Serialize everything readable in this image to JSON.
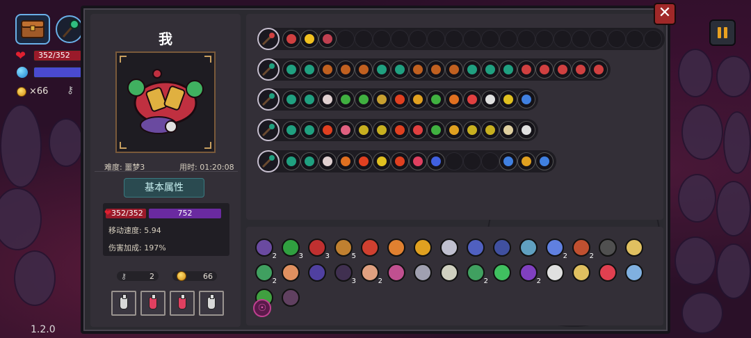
{
  "hud": {
    "hp": "352/352",
    "coins": "×66",
    "version": "1.2.0"
  },
  "player": {
    "name": "我",
    "difficulty": "难度: 噩梦3",
    "time": "用时: 01:20:08"
  },
  "stats": {
    "section_title": "基本属性",
    "hp": "352/352",
    "mp": "752",
    "move_speed": "移动速度: 5.94",
    "damage_bonus": "伤害加成: 197%"
  },
  "resources": {
    "keys": "2",
    "coins": "66"
  },
  "potions": [
    {
      "name": "empty-flask",
      "color": "#d8d8d8"
    },
    {
      "name": "health-potion",
      "color": "#e04060"
    },
    {
      "name": "health-potion",
      "color": "#e04060"
    },
    {
      "name": "empty-flask",
      "color": "#d8d8d8"
    }
  ],
  "loadout_rows": [
    {
      "weapon": "chest-bag-icon",
      "chips": [
        "#d04040",
        "#f0c020",
        "#c04050",
        "",
        "",
        "",
        "",
        "",
        "",
        "",
        "",
        "",
        "",
        "",
        "",
        "",
        "",
        "",
        "",
        "",
        ""
      ]
    },
    {
      "weapon": "green-staff-icon",
      "chips": [
        "#20a080",
        "#20a080",
        "#c06020",
        "#c06020",
        "#c06020",
        "#20a080",
        "#20a080",
        "#c06020",
        "#c06020",
        "#c06020",
        "#20a080",
        "#20a080",
        "#20a080",
        "#d04040",
        "#d04040",
        "#d04040",
        "#d04040",
        "#d04040"
      ]
    },
    {
      "weapon": "purple-staff-icon",
      "chips": [
        "#20a080",
        "#20a080",
        "#e0d0d0",
        "#40b040",
        "#40b040",
        "#c8a030",
        "#e04020",
        "#e0a020",
        "#40b040",
        "#e07020",
        "#e04040",
        "#e0e0e0",
        "#e0c020",
        "#4080e0"
      ]
    },
    {
      "weapon": "dark-staff-icon",
      "chips": [
        "#20a080",
        "#20a080",
        "#e04020",
        "#e06080",
        "#c8b020",
        "#c8b020",
        "#e04020",
        "#e04040",
        "#40b040",
        "#e0a020",
        "#c8b020",
        "#c8b020",
        "#e0d0a0",
        "#e0e0e0"
      ]
    },
    {
      "weapon": "spiked-staff-icon",
      "chips": [
        "#20a080",
        "#20a080",
        "#e0d0d0",
        "#e07020",
        "#e04020",
        "#e0c020",
        "#e04020",
        "#e04060",
        "#4060e0",
        "",
        "",
        "",
        "#4080e0",
        "#e0a020",
        "#4080e0"
      ]
    }
  ],
  "inventory": [
    {
      "name": "hood-item",
      "color": "#6a4aa0",
      "count": "2"
    },
    {
      "name": "claw-item",
      "color": "#30a040",
      "count": "3"
    },
    {
      "name": "demon-mask-item",
      "color": "#c03030",
      "count": "3"
    },
    {
      "name": "pickaxe-item",
      "color": "#c08030",
      "count": "5"
    },
    {
      "name": "eye-bat-item",
      "color": "#d04030",
      "count": ""
    },
    {
      "name": "scroll-item",
      "color": "#e08030",
      "count": ""
    },
    {
      "name": "glove-item",
      "color": "#e0a020",
      "count": ""
    },
    {
      "name": "dagger-item",
      "color": "#c0c0d0",
      "count": ""
    },
    {
      "name": "grimoire-item",
      "color": "#5060c0",
      "count": ""
    },
    {
      "name": "beetle-item",
      "color": "#4050a0",
      "count": ""
    },
    {
      "name": "compass-item",
      "color": "#60a0c0",
      "count": ""
    },
    {
      "name": "flower-item",
      "color": "#6080e0",
      "count": "2"
    },
    {
      "name": "bomb-item",
      "color": "#c05030",
      "count": "2"
    },
    {
      "name": "hat-item",
      "color": "#505050",
      "count": ""
    },
    {
      "name": "bread-item",
      "color": "#e0c060",
      "count": ""
    },
    {
      "name": "gem-item",
      "color": "#40a060",
      "count": "2"
    },
    {
      "name": "egg-item",
      "color": "#e09060",
      "count": ""
    },
    {
      "name": "rune-item",
      "color": "#5040a0",
      "count": ""
    },
    {
      "name": "cloak-item",
      "color": "#403050",
      "count": "3"
    },
    {
      "name": "fairy-item",
      "color": "#e0a080",
      "count": "2"
    },
    {
      "name": "brain-item",
      "color": "#c05090",
      "count": ""
    },
    {
      "name": "magnifier-item",
      "color": "#a0a0b0",
      "count": ""
    },
    {
      "name": "worm-item",
      "color": "#d0d0c0",
      "count": ""
    },
    {
      "name": "pants-item",
      "color": "#40a060",
      "count": "2"
    },
    {
      "name": "clover-item",
      "color": "#40c060",
      "count": ""
    },
    {
      "name": "wizard-hat-item",
      "color": "#8040c0",
      "count": "2"
    },
    {
      "name": "fangs-item",
      "color": "#e0e0e0",
      "count": ""
    },
    {
      "name": "bones-item",
      "color": "#e0c060",
      "count": ""
    },
    {
      "name": "heart-item",
      "color": "#e04050",
      "count": ""
    },
    {
      "name": "lens-item",
      "color": "#80b0e0",
      "count": ""
    },
    {
      "name": "frog-item",
      "color": "#40a040",
      "count": ""
    },
    {
      "name": "spirit-item",
      "color": "#604060",
      "count": ""
    }
  ],
  "curse": {
    "icon": "curse-sigil-icon"
  }
}
